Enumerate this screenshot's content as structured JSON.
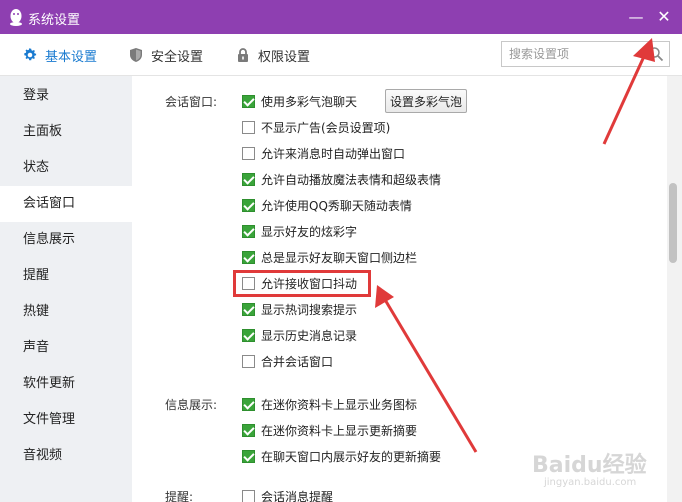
{
  "window": {
    "title": "系统设置",
    "minimize_glyph": "—",
    "close_glyph": "✕"
  },
  "tabs": [
    {
      "label": "基本设置",
      "icon": "gear-icon",
      "active": true
    },
    {
      "label": "安全设置",
      "icon": "shield-icon",
      "active": false
    },
    {
      "label": "权限设置",
      "icon": "lock-icon",
      "active": false
    }
  ],
  "search": {
    "placeholder": "搜索设置项",
    "value": ""
  },
  "sidebar": {
    "items": [
      {
        "label": "登录"
      },
      {
        "label": "主面板"
      },
      {
        "label": "状态"
      },
      {
        "label": "会话窗口",
        "active": true
      },
      {
        "label": "信息展示"
      },
      {
        "label": "提醒"
      },
      {
        "label": "热键"
      },
      {
        "label": "声音"
      },
      {
        "label": "软件更新"
      },
      {
        "label": "文件管理"
      },
      {
        "label": "音视频"
      }
    ]
  },
  "sections": {
    "chat": {
      "label": "会话窗口:",
      "button": "设置多彩气泡",
      "options": [
        {
          "label": "使用多彩气泡聊天",
          "checked": true
        },
        {
          "label": "不显示广告(会员设置项)",
          "checked": false
        },
        {
          "label": "允许来消息时自动弹出窗口",
          "checked": false
        },
        {
          "label": "允许自动播放魔法表情和超级表情",
          "checked": true
        },
        {
          "label": "允许使用QQ秀聊天随动表情",
          "checked": true
        },
        {
          "label": "显示好友的炫彩字",
          "checked": true
        },
        {
          "label": "总是显示好友聊天窗口侧边栏",
          "checked": true
        },
        {
          "label": "允许接收窗口抖动",
          "checked": false
        },
        {
          "label": "显示热词搜索提示",
          "checked": true
        },
        {
          "label": "显示历史消息记录",
          "checked": true
        },
        {
          "label": "合并会话窗口",
          "checked": false
        }
      ]
    },
    "info": {
      "label": "信息展示:",
      "options": [
        {
          "label": "在迷你资料卡上显示业务图标",
          "checked": true
        },
        {
          "label": "在迷你资料卡上显示更新摘要",
          "checked": true
        },
        {
          "label": "在聊天窗口内展示好友的更新摘要",
          "checked": true
        }
      ]
    },
    "remind": {
      "label": "提醒:",
      "options": [
        {
          "label": "会话消息提醒",
          "checked": false
        }
      ]
    }
  },
  "colors": {
    "titlebar": "#8e3fb1",
    "accent": "#1a7bd0",
    "checked": "#3aa43a",
    "annotation": "#e03a3a"
  },
  "watermark": {
    "logo": "Baidu经验",
    "sub": "jingyan.baidu.com"
  }
}
